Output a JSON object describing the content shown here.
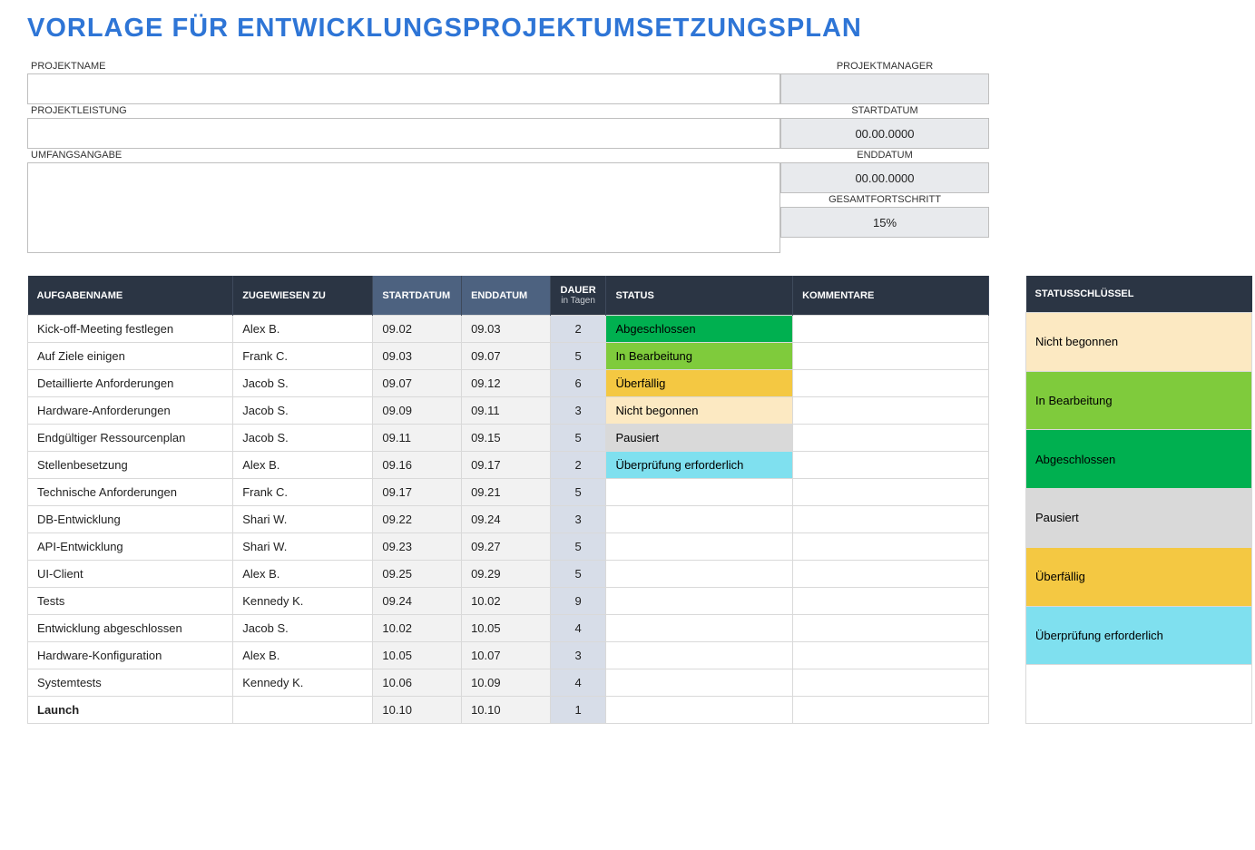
{
  "title": "VORLAGE FÜR ENTWICKLUNGSPROJEKTUMSETZUNGSPLAN",
  "labels": {
    "projektname": "PROJEKTNAME",
    "projektmanager": "PROJEKTMANAGER",
    "projektleistung": "PROJEKTLEISTUNG",
    "startdatum": "STARTDATUM",
    "umfangsangabe": "UMFANGSANGABE",
    "enddatum": "ENDDATUM",
    "gesamtfortschritt": "GESAMTFORTSCHRITT"
  },
  "values": {
    "projektname": "",
    "projektmanager": "",
    "projektleistung": "",
    "startdatum": "00.00.0000",
    "umfangsangabe": "",
    "enddatum": "00.00.0000",
    "gesamtfortschritt": "15%"
  },
  "taskHeaders": {
    "aufgabenname": "AUFGABENNAME",
    "zugewiesen": "ZUGEWIESEN ZU",
    "startdatum": "STARTDATUM",
    "enddatum": "ENDDATUM",
    "dauer": "DAUER",
    "dauerSub": "in Tagen",
    "status": "STATUS",
    "kommentare": "KOMMENTARE"
  },
  "statusColors": {
    "Abgeschlossen": "st-complete",
    "In Bearbeitung": "st-inprogress",
    "Überfällig": "st-overdue",
    "Nicht begonnen": "st-notstarted",
    "Pausiert": "st-paused",
    "Überprüfung erforderlich": "st-review",
    "": "st-blank"
  },
  "tasks": [
    {
      "name": "Kick-off-Meeting festlegen",
      "assigned": "Alex B.",
      "start": "09.02",
      "end": "09.03",
      "dur": "2",
      "status": "Abgeschlossen",
      "bold": false
    },
    {
      "name": "Auf Ziele einigen",
      "assigned": "Frank C.",
      "start": "09.03",
      "end": "09.07",
      "dur": "5",
      "status": "In Bearbeitung",
      "bold": false
    },
    {
      "name": "Detaillierte Anforderungen",
      "assigned": "Jacob S.",
      "start": "09.07",
      "end": "09.12",
      "dur": "6",
      "status": "Überfällig",
      "bold": false
    },
    {
      "name": "Hardware-Anforderungen",
      "assigned": "Jacob S.",
      "start": "09.09",
      "end": "09.11",
      "dur": "3",
      "status": "Nicht begonnen",
      "bold": false
    },
    {
      "name": "Endgültiger Ressourcenplan",
      "assigned": "Jacob S.",
      "start": "09.11",
      "end": "09.15",
      "dur": "5",
      "status": "Pausiert",
      "bold": false
    },
    {
      "name": "Stellenbesetzung",
      "assigned": "Alex B.",
      "start": "09.16",
      "end": "09.17",
      "dur": "2",
      "status": "Überprüfung erforderlich",
      "bold": false
    },
    {
      "name": "Technische Anforderungen",
      "assigned": "Frank C.",
      "start": "09.17",
      "end": "09.21",
      "dur": "5",
      "status": "",
      "bold": false
    },
    {
      "name": "DB-Entwicklung",
      "assigned": "Shari W.",
      "start": "09.22",
      "end": "09.24",
      "dur": "3",
      "status": "",
      "bold": false
    },
    {
      "name": "API-Entwicklung",
      "assigned": "Shari W.",
      "start": "09.23",
      "end": "09.27",
      "dur": "5",
      "status": "",
      "bold": false
    },
    {
      "name": "UI-Client",
      "assigned": "Alex B.",
      "start": "09.25",
      "end": "09.29",
      "dur": "5",
      "status": "",
      "bold": false
    },
    {
      "name": "Tests",
      "assigned": "Kennedy K.",
      "start": "09.24",
      "end": "10.02",
      "dur": "9",
      "status": "",
      "bold": false
    },
    {
      "name": "Entwicklung abgeschlossen",
      "assigned": "Jacob S.",
      "start": "10.02",
      "end": "10.05",
      "dur": "4",
      "status": "",
      "bold": false
    },
    {
      "name": "Hardware-Konfiguration",
      "assigned": "Alex B.",
      "start": "10.05",
      "end": "10.07",
      "dur": "3",
      "status": "",
      "bold": false
    },
    {
      "name": "Systemtests",
      "assigned": "Kennedy K.",
      "start": "10.06",
      "end": "10.09",
      "dur": "4",
      "status": "",
      "bold": false
    },
    {
      "name": "Launch",
      "assigned": "",
      "start": "10.10",
      "end": "10.10",
      "dur": "1",
      "status": "",
      "bold": true
    }
  ],
  "legendHeader": "STATUSSCHLÜSSEL",
  "legendItems": [
    "Nicht begonnen",
    "In Bearbeitung",
    "Abgeschlossen",
    "Pausiert",
    "Überfällig",
    "Überprüfung erforderlich",
    ""
  ]
}
